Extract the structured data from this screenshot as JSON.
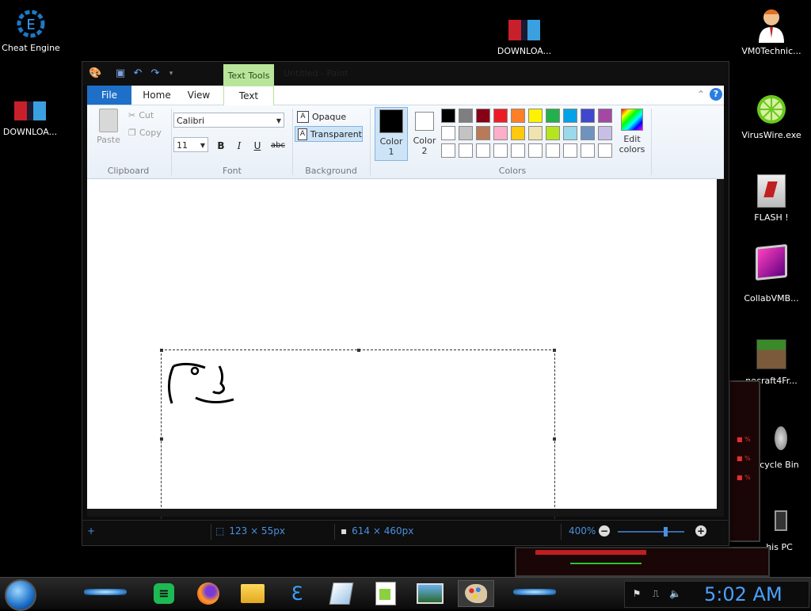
{
  "desktop": {
    "icons": [
      {
        "label": "Cheat Engine"
      },
      {
        "label": "DOWNLOA..."
      },
      {
        "label": "DOWNLOA..."
      },
      {
        "label": "VM0Technic..."
      },
      {
        "label": "VirusWire.exe"
      },
      {
        "label": "FLASH !"
      },
      {
        "label": "CollabVMB..."
      },
      {
        "label": "necraft4Fr..."
      },
      {
        "label": "cycle Bin"
      },
      {
        "label": "his PC"
      }
    ]
  },
  "paint": {
    "contextual_tab": "Text Tools",
    "title": "Untitled - Paint",
    "tabs": {
      "file": "File",
      "home": "Home",
      "view": "View",
      "text": "Text"
    },
    "clipboard": {
      "paste": "Paste",
      "cut": "Cut",
      "copy": "Copy",
      "group": "Clipboard"
    },
    "font": {
      "family": "Calibri",
      "size": "11",
      "bold": "B",
      "italic": "I",
      "underline": "U",
      "strike": "abc",
      "group": "Font"
    },
    "background": {
      "opaque": "Opaque",
      "transparent": "Transparent",
      "group": "Background"
    },
    "colors": {
      "color1_label": "Color 1",
      "color2_label": "Color 2",
      "edit_label": "Edit colors",
      "group": "Colors",
      "color1": "#000000",
      "color2": "#ffffff",
      "palette": [
        "#000000",
        "#7f7f7f",
        "#880015",
        "#ed1c24",
        "#ff7f27",
        "#fff200",
        "#22b14c",
        "#00a2e8",
        "#3f48cc",
        "#a349a4",
        "#ffffff",
        "#c3c3c3",
        "#b97a57",
        "#ffaec9",
        "#ffc90e",
        "#efe4b0",
        "#b5e61d",
        "#99d9ea",
        "#7092be",
        "#c8bfe7",
        "#ffffff",
        "#ffffff",
        "#ffffff",
        "#ffffff",
        "#ffffff",
        "#ffffff",
        "#ffffff",
        "#ffffff",
        "#ffffff",
        "#ffffff"
      ]
    },
    "status": {
      "selection": "123 × 55px",
      "size": "614 × 460px",
      "zoom": "400%"
    }
  },
  "taskbar": {
    "clock": "5:02 AM"
  }
}
